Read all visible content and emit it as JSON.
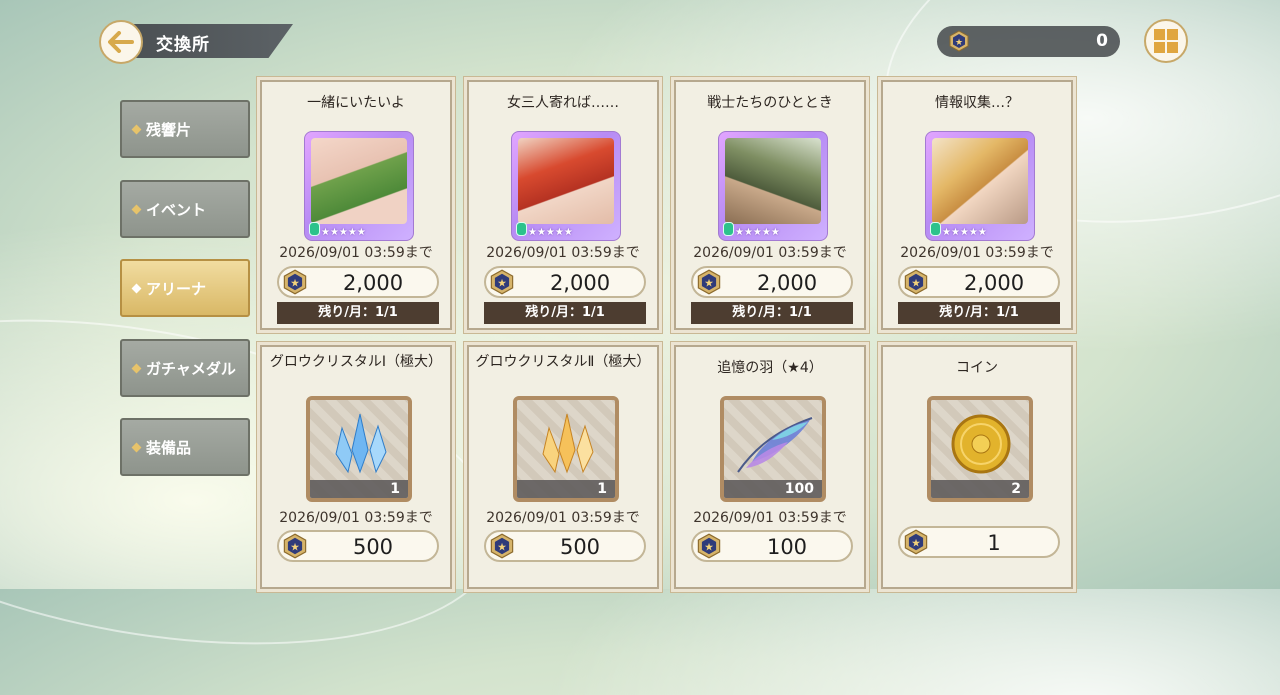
{
  "header": {
    "title": "交換所",
    "currency_value": "0"
  },
  "tabs": [
    {
      "label": "残響片",
      "active": false
    },
    {
      "label": "イベント",
      "active": false
    },
    {
      "label": "アリーナ",
      "active": true
    },
    {
      "label": "ガチャメダル",
      "active": false
    },
    {
      "label": "装備品",
      "active": false
    }
  ],
  "cards": [
    {
      "title": "一緒にいたいよ",
      "deadline": "2026/09/01 03:59まで",
      "price": "2,000",
      "remaining": "残り/月：1/1",
      "type": "memory",
      "stars": "★★★★★"
    },
    {
      "title": "女三人寄れば……",
      "deadline": "2026/09/01 03:59まで",
      "price": "2,000",
      "remaining": "残り/月：1/1",
      "type": "memory",
      "stars": "★★★★★"
    },
    {
      "title": "戦士たちのひととき",
      "deadline": "2026/09/01 03:59まで",
      "price": "2,000",
      "remaining": "残り/月：1/1",
      "type": "memory",
      "stars": "★★★★★"
    },
    {
      "title": "情報収集…？",
      "deadline": "2026/09/01 03:59まで",
      "price": "2,000",
      "remaining": "残り/月：1/1",
      "type": "memory",
      "stars": "★★★★★"
    },
    {
      "title": "グロウクリスタルⅠ（極大）",
      "deadline": "2026/09/01 03:59まで",
      "price": "500",
      "quantity": "1",
      "type": "item",
      "icon": "blue-crystal"
    },
    {
      "title": "グロウクリスタルⅡ（極大）",
      "deadline": "2026/09/01 03:59まで",
      "price": "500",
      "quantity": "1",
      "type": "item",
      "icon": "gold-crystal"
    },
    {
      "title": "追憶の羽（★4）",
      "deadline": "2026/09/01 03:59まで",
      "price": "100",
      "quantity": "100",
      "type": "item",
      "icon": "feather"
    },
    {
      "title": "コイン",
      "deadline": "",
      "price": "1",
      "quantity": "2",
      "type": "item",
      "icon": "gold-coin"
    }
  ],
  "colors": {
    "accent_gold": "#d9b866",
    "remaining_bar": "#4d3d30",
    "tab_inactive": "#9ba096"
  }
}
